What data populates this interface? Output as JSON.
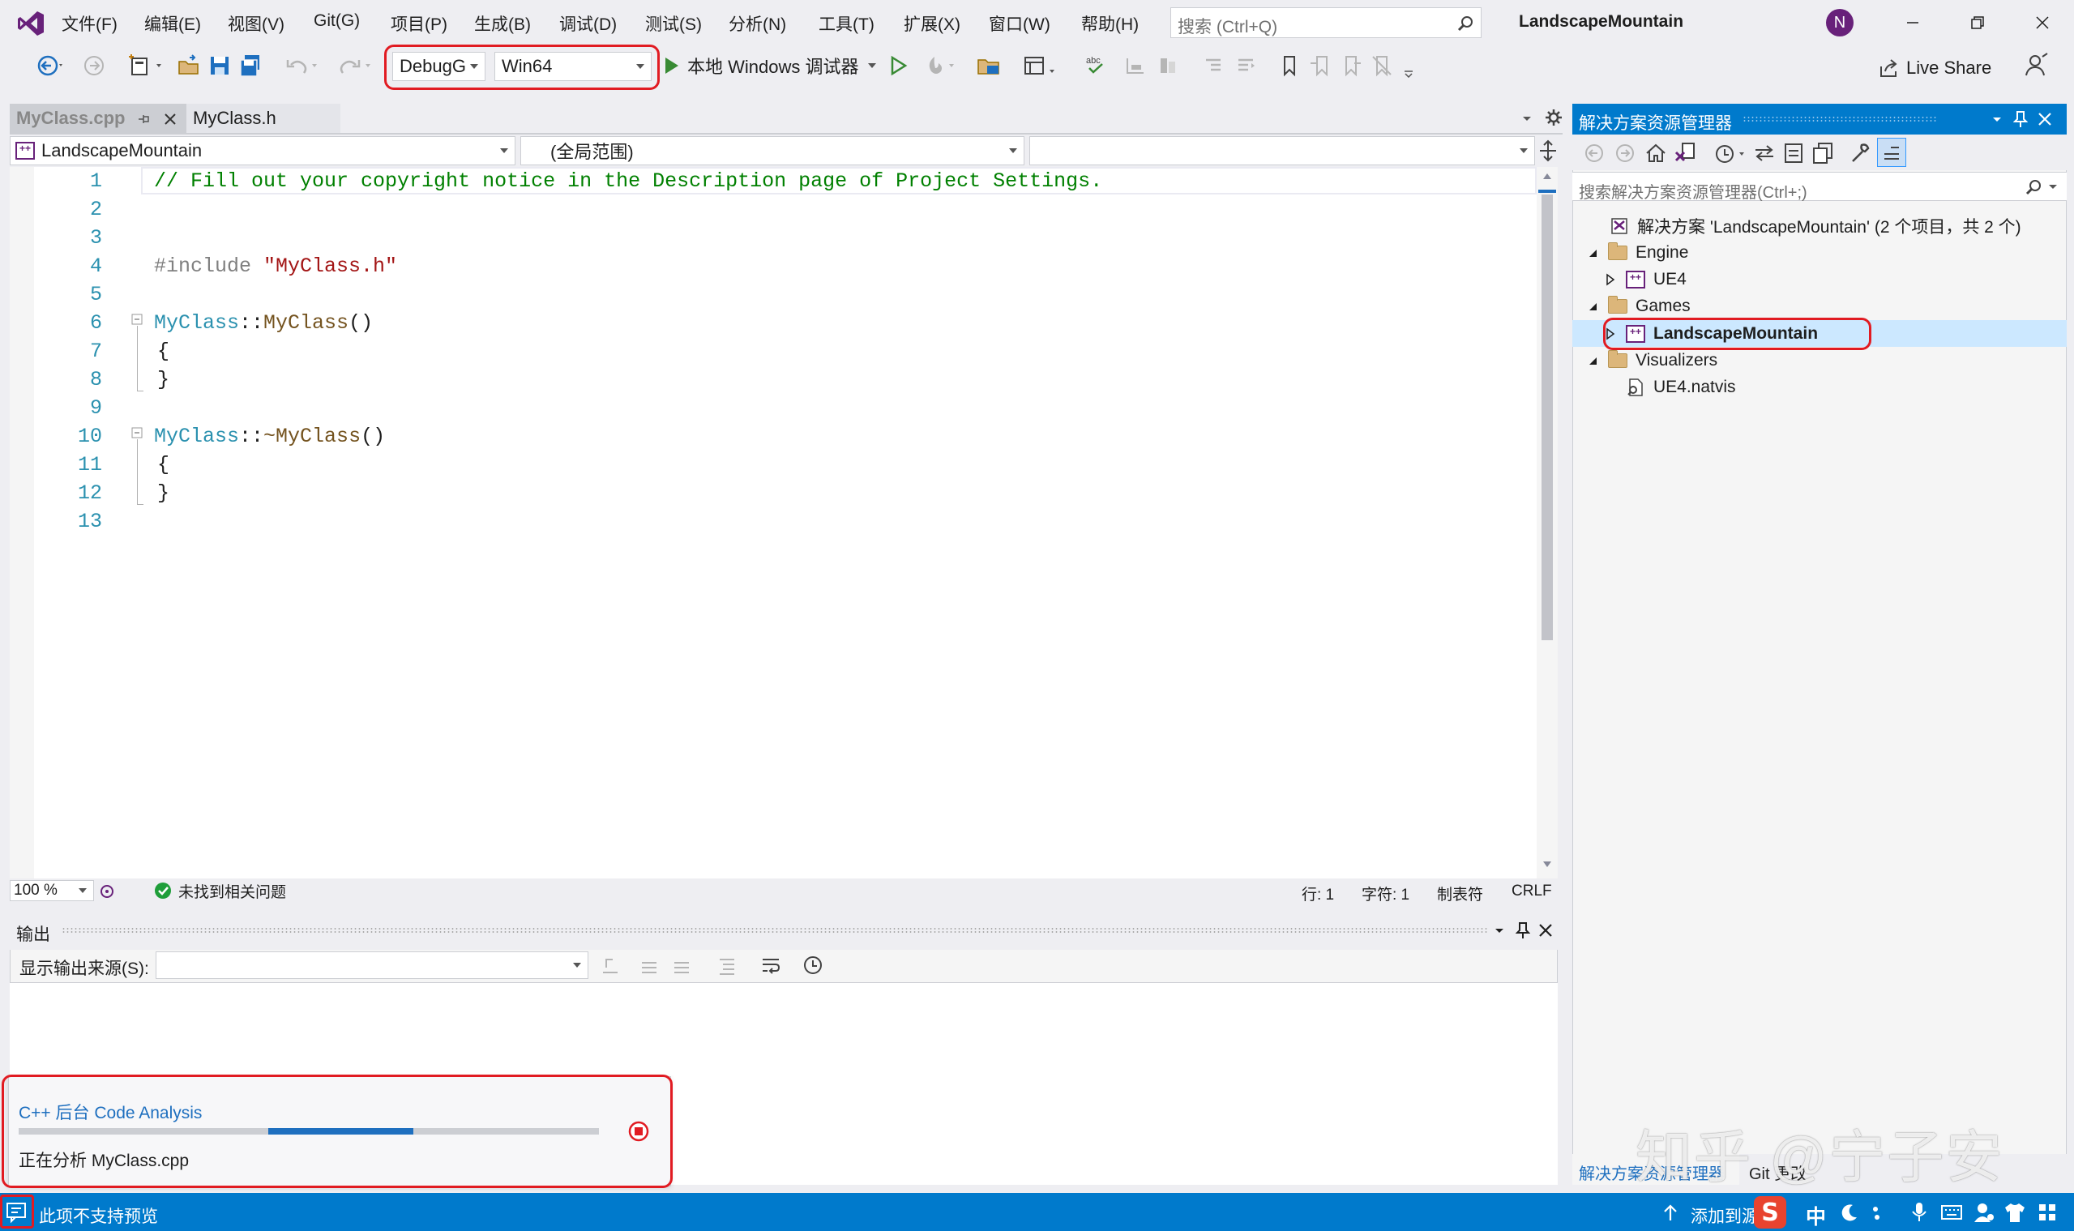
{
  "menu": {
    "items": [
      "文件(F)",
      "编辑(E)",
      "视图(V)",
      "Git(G)",
      "项目(P)",
      "生成(B)",
      "调试(D)",
      "测试(S)",
      "分析(N)",
      "工具(T)",
      "扩展(X)",
      "窗口(W)",
      "帮助(H)"
    ],
    "search_placeholder": "搜索 (Ctrl+Q)",
    "window_title": "LandscapeMountain",
    "avatar_letter": "N"
  },
  "toolbar": {
    "config": "DebugG",
    "platform": "Win64",
    "run_label": "本地 Windows 调试器",
    "live_share": "Live Share"
  },
  "editor": {
    "tabs": [
      "MyClass.cpp",
      "MyClass.h"
    ],
    "nav_project": "LandscapeMountain",
    "nav_scope": "(全局范围)",
    "nav_member": "",
    "lines": [
      {
        "n": "1",
        "segments": [
          {
            "t": "// Fill out your copyright notice in the Description page of Project Settings.",
            "c": "comment"
          }
        ]
      },
      {
        "n": "2",
        "segments": []
      },
      {
        "n": "3",
        "segments": []
      },
      {
        "n": "4",
        "segments": [
          {
            "t": "#include ",
            "c": "pp"
          },
          {
            "t": "\"MyClass.h\"",
            "c": "str"
          }
        ]
      },
      {
        "n": "5",
        "segments": []
      },
      {
        "n": "6",
        "segments": [
          {
            "t": "MyClass",
            "c": "type"
          },
          {
            "t": "::",
            "c": "plain"
          },
          {
            "t": "MyClass",
            "c": "fn"
          },
          {
            "t": "()",
            "c": "plain"
          }
        ]
      },
      {
        "n": "7",
        "segments": [
          {
            "t": "{",
            "c": "plain"
          }
        ]
      },
      {
        "n": "8",
        "segments": [
          {
            "t": "}",
            "c": "plain"
          }
        ]
      },
      {
        "n": "9",
        "segments": []
      },
      {
        "n": "10",
        "segments": [
          {
            "t": "MyClass",
            "c": "type"
          },
          {
            "t": "::",
            "c": "plain"
          },
          {
            "t": "~MyClass",
            "c": "fn"
          },
          {
            "t": "()",
            "c": "plain"
          }
        ]
      },
      {
        "n": "11",
        "segments": [
          {
            "t": "{",
            "c": "plain"
          }
        ]
      },
      {
        "n": "12",
        "segments": [
          {
            "t": "}",
            "c": "plain"
          }
        ]
      },
      {
        "n": "13",
        "segments": []
      }
    ],
    "zoom": "100 %",
    "issues": "未找到相关问题",
    "row": "行: 1",
    "col": "字符: 1",
    "tabs_mode": "制表符",
    "eol": "CRLF"
  },
  "solution_explorer": {
    "title": "解决方案资源管理器",
    "search_placeholder": "搜索解决方案资源管理器(Ctrl+;)",
    "items": [
      {
        "label": "解决方案 'LandscapeMountain' (2 个项目，共 2 个)",
        "kind": "solution",
        "depth": 0,
        "toggle": "none"
      },
      {
        "label": "Engine",
        "kind": "folder",
        "depth": 1,
        "toggle": "open"
      },
      {
        "label": "UE4",
        "kind": "project",
        "depth": 2,
        "toggle": "closed"
      },
      {
        "label": "Games",
        "kind": "folder",
        "depth": 1,
        "toggle": "open"
      },
      {
        "label": "LandscapeMountain",
        "kind": "project",
        "depth": 2,
        "toggle": "closed",
        "selected": true
      },
      {
        "label": "Visualizers",
        "kind": "folder",
        "depth": 1,
        "toggle": "open"
      },
      {
        "label": "UE4.natvis",
        "kind": "file",
        "depth": 2,
        "toggle": "none"
      }
    ],
    "bottom_tabs": [
      "解决方案资源管理器",
      "Git 更改"
    ]
  },
  "output": {
    "title": "输出",
    "source_label": "显示输出来源(S):",
    "source_value": ""
  },
  "analysis": {
    "title": "C++ 后台 Code Analysis",
    "status": "正在分析 MyClass.cpp",
    "progress_start": 0.43,
    "progress_end": 0.68
  },
  "statusbar": {
    "text": "此项不支持预览",
    "add_source": "添加到源",
    "ime": "中"
  },
  "watermark": "知乎 @宁子安",
  "colors": {
    "accent": "#007acc",
    "highlight": "#e11b22",
    "comment": "#008000",
    "string": "#a31515",
    "type": "#2b91af",
    "fn": "#74531f",
    "pp": "#808080"
  }
}
